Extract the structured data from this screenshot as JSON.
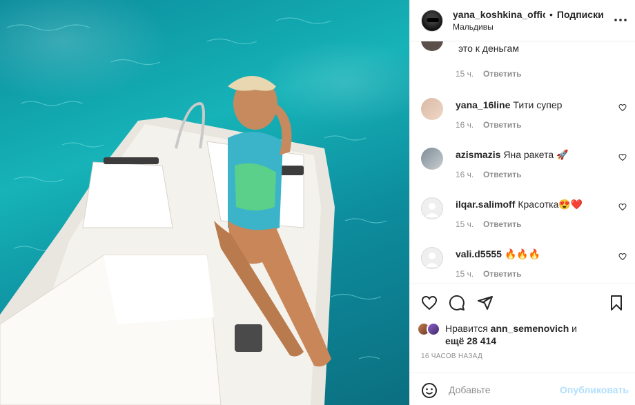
{
  "post": {
    "username": "yana_koshkina_offic",
    "separator": "•",
    "follow_label": "Подписки",
    "location": "Мальдивы"
  },
  "comments": [
    {
      "username": "",
      "text": "это к деньгам",
      "time": "15 ч.",
      "reply_label": "Ответить"
    },
    {
      "username": "yana_16line",
      "text": "Тити супер",
      "time": "16 ч.",
      "reply_label": "Ответить"
    },
    {
      "username": "azismazis",
      "text": "Яна ракета 🚀",
      "time": "16 ч.",
      "reply_label": "Ответить"
    },
    {
      "username": "ilqar.salimoff",
      "text": "Красотка😍❤️",
      "time": "15 ч.",
      "reply_label": "Ответить"
    },
    {
      "username": "vali.d5555",
      "text": "🔥🔥🔥",
      "time": "15 ч.",
      "reply_label": "Ответить"
    }
  ],
  "likes": {
    "prefix": "Нравится",
    "user": "ann_semenovich",
    "conj": "и",
    "rest": "ещё 28 414"
  },
  "date_label": "16 ЧАСОВ НАЗАД",
  "add_comment": {
    "placeholder": "Добавьте",
    "publish_label": "Опубликовать"
  },
  "icons": {
    "like": "heart-icon",
    "comment": "comment-icon",
    "share": "send-icon",
    "save": "bookmark-icon",
    "more": "more-icon",
    "emoji": "emoji-icon"
  },
  "colors": {
    "text": "#262626",
    "muted": "#8e8e8e",
    "publish_disabled": "#b2dffc",
    "border": "#efefef"
  }
}
